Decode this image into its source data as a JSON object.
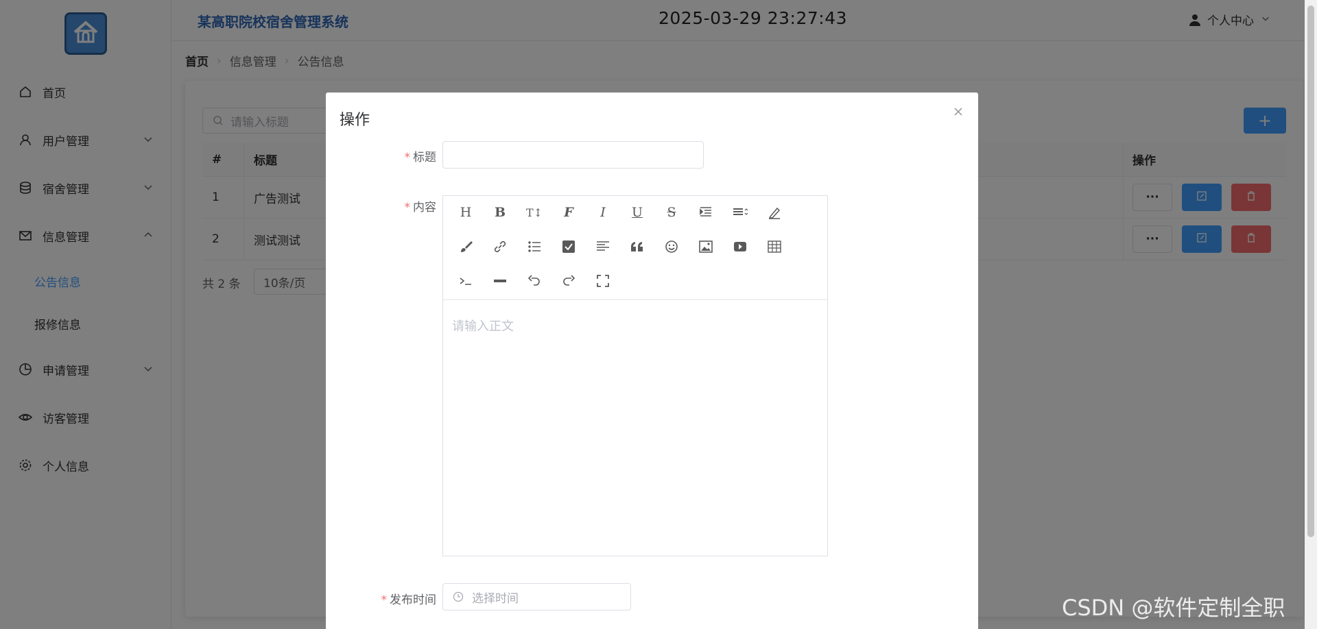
{
  "header": {
    "system_title": "某高职院校宿舍管理系统",
    "clock": "2025-03-29 23:27:43",
    "user_center": "个人中心"
  },
  "sidebar": {
    "logo_icon": "house-icon",
    "items": [
      {
        "label": "首页",
        "icon": "home-icon"
      },
      {
        "label": "用户管理",
        "icon": "user-icon"
      },
      {
        "label": "宿舍管理",
        "icon": "database-icon"
      },
      {
        "label": "信息管理",
        "icon": "mail-icon"
      },
      {
        "label": "申请管理",
        "icon": "pie-chart-icon"
      },
      {
        "label": "访客管理",
        "icon": "eye-icon"
      },
      {
        "label": "个人信息",
        "icon": "gear-icon"
      }
    ],
    "submenu": [
      {
        "label": "公告信息",
        "active": true
      },
      {
        "label": "报修信息",
        "active": false
      }
    ]
  },
  "breadcrumb": [
    "首页",
    "信息管理",
    "公告信息"
  ],
  "list": {
    "search_placeholder": "请输入标题",
    "add_label": "+",
    "columns": {
      "num": "#",
      "title": "标题",
      "op": "操作"
    },
    "rows": [
      {
        "num": "1",
        "title": "广告测试"
      },
      {
        "num": "2",
        "title": "测试测试"
      }
    ],
    "more_label": "···",
    "total": "共 2 条",
    "page_size": "10条/页"
  },
  "dialog": {
    "title": "操作",
    "required_mark": "*",
    "title_label": "标题",
    "content_label": "内容",
    "publish_label": "发布时间",
    "title_value": "",
    "editor_placeholder": "请输入正文",
    "date_placeholder": "选择时间",
    "toolbar": {
      "heading": "H",
      "bold": "B",
      "font_size": "T↕",
      "font_family": "F",
      "italic": "I",
      "underline": "U",
      "strike": "S"
    }
  },
  "watermark": "CSDN @软件定制全职",
  "colors": {
    "primary": "#409eff",
    "danger": "#f56c6c",
    "brand_title": "#2f67b6"
  }
}
